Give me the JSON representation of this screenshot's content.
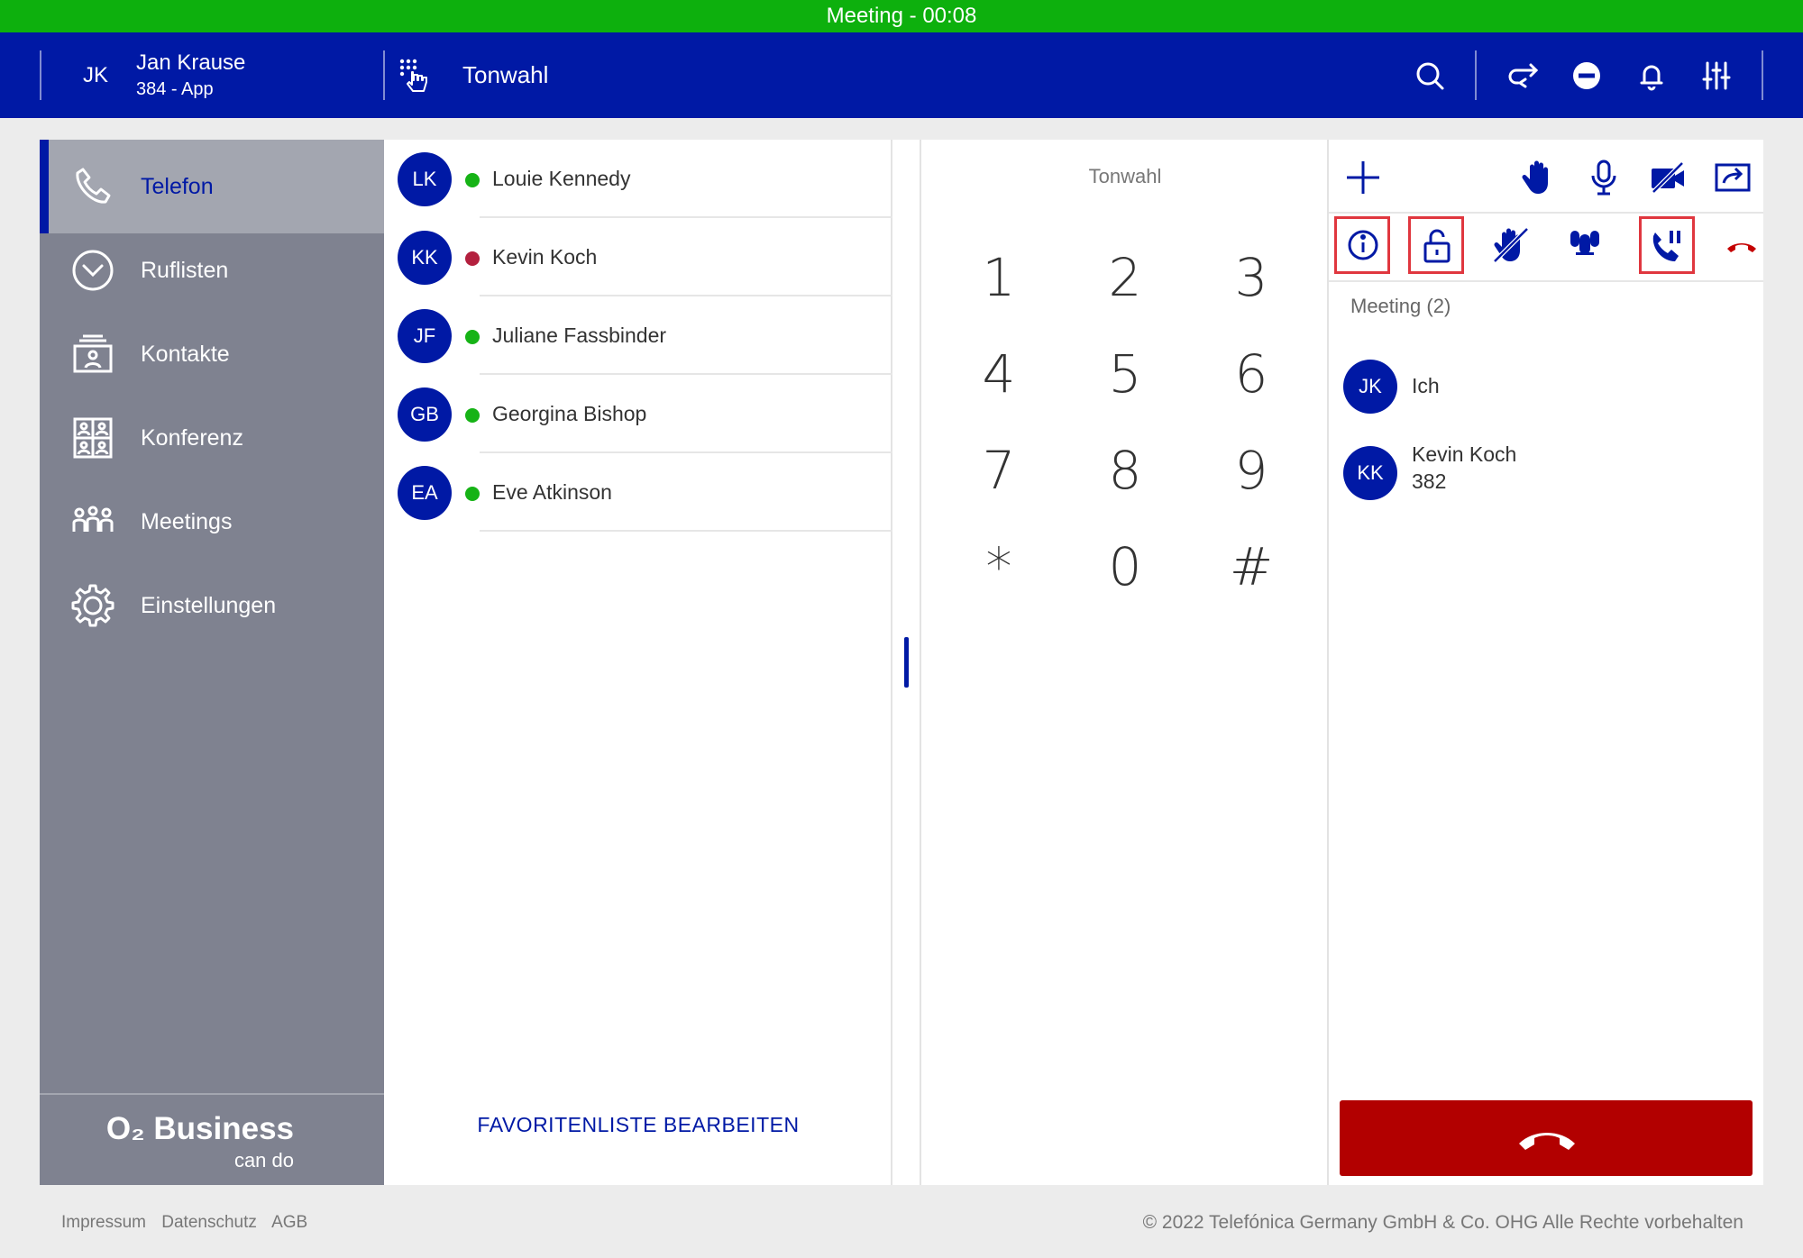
{
  "status_bar": {
    "text": "Meeting - 00:08"
  },
  "header": {
    "user_initials": "JK",
    "user_name": "Jan Krause",
    "user_ext": "384 - App",
    "title": "Tonwahl",
    "icons": [
      "search-icon",
      "call-forward-icon",
      "do-not-disturb-icon",
      "bell-icon",
      "settings-sliders-icon"
    ]
  },
  "sidebar": {
    "items": [
      {
        "label": "Telefon",
        "icon": "phone-icon",
        "active": true
      },
      {
        "label": "Ruflisten",
        "icon": "clock-icon"
      },
      {
        "label": "Kontakte",
        "icon": "contacts-icon"
      },
      {
        "label": "Konferenz",
        "icon": "conference-icon"
      },
      {
        "label": "Meetings",
        "icon": "meetings-icon"
      },
      {
        "label": "Einstellungen",
        "icon": "gear-icon"
      }
    ],
    "brand_main": "O₂ Business",
    "brand_sub": "can do"
  },
  "favorites": {
    "items": [
      {
        "initials": "LK",
        "name": "Louie Kennedy",
        "status_color": "#16b316"
      },
      {
        "initials": "KK",
        "name": "Kevin Koch",
        "status_color": "#b3203e"
      },
      {
        "initials": "JF",
        "name": "Juliane Fassbinder",
        "status_color": "#16b316"
      },
      {
        "initials": "GB",
        "name": "Georgina Bishop",
        "status_color": "#16b316"
      },
      {
        "initials": "EA",
        "name": "Eve Atkinson",
        "status_color": "#16b316"
      }
    ],
    "edit_label": "FAVORITENLISTE BEARBEITEN"
  },
  "dialpad": {
    "title": "Tonwahl",
    "keys": [
      "1",
      "2",
      "3",
      "4",
      "5",
      "6",
      "7",
      "8",
      "9",
      "*",
      "0",
      "#"
    ]
  },
  "meeting": {
    "toolbar_top": [
      "add-icon",
      "raise-hand-icon",
      "microphone-icon",
      "video-off-icon",
      "share-screen-icon"
    ],
    "toolbar_bottom": [
      "info-icon",
      "lock-open-icon",
      "lower-all-hands-icon",
      "mute-all-icon",
      "call-moderator-icon",
      "leave-call-icon"
    ],
    "count_label": "Meeting (2)",
    "participants": [
      {
        "initials": "JK",
        "name": "Ich",
        "ext": ""
      },
      {
        "initials": "KK",
        "name": "Kevin Koch",
        "ext": "382"
      }
    ]
  },
  "footer": {
    "links": [
      "Impressum",
      "Datenschutz",
      "AGB"
    ],
    "copyright": "© 2022 Telefónica Germany GmbH & Co. OHG Alle Rechte vorbehalten"
  },
  "colors": {
    "brand_blue": "#0019a5",
    "status_green": "#0db00d",
    "hangup_red": "#b20000",
    "highlight": "#e0373f"
  }
}
